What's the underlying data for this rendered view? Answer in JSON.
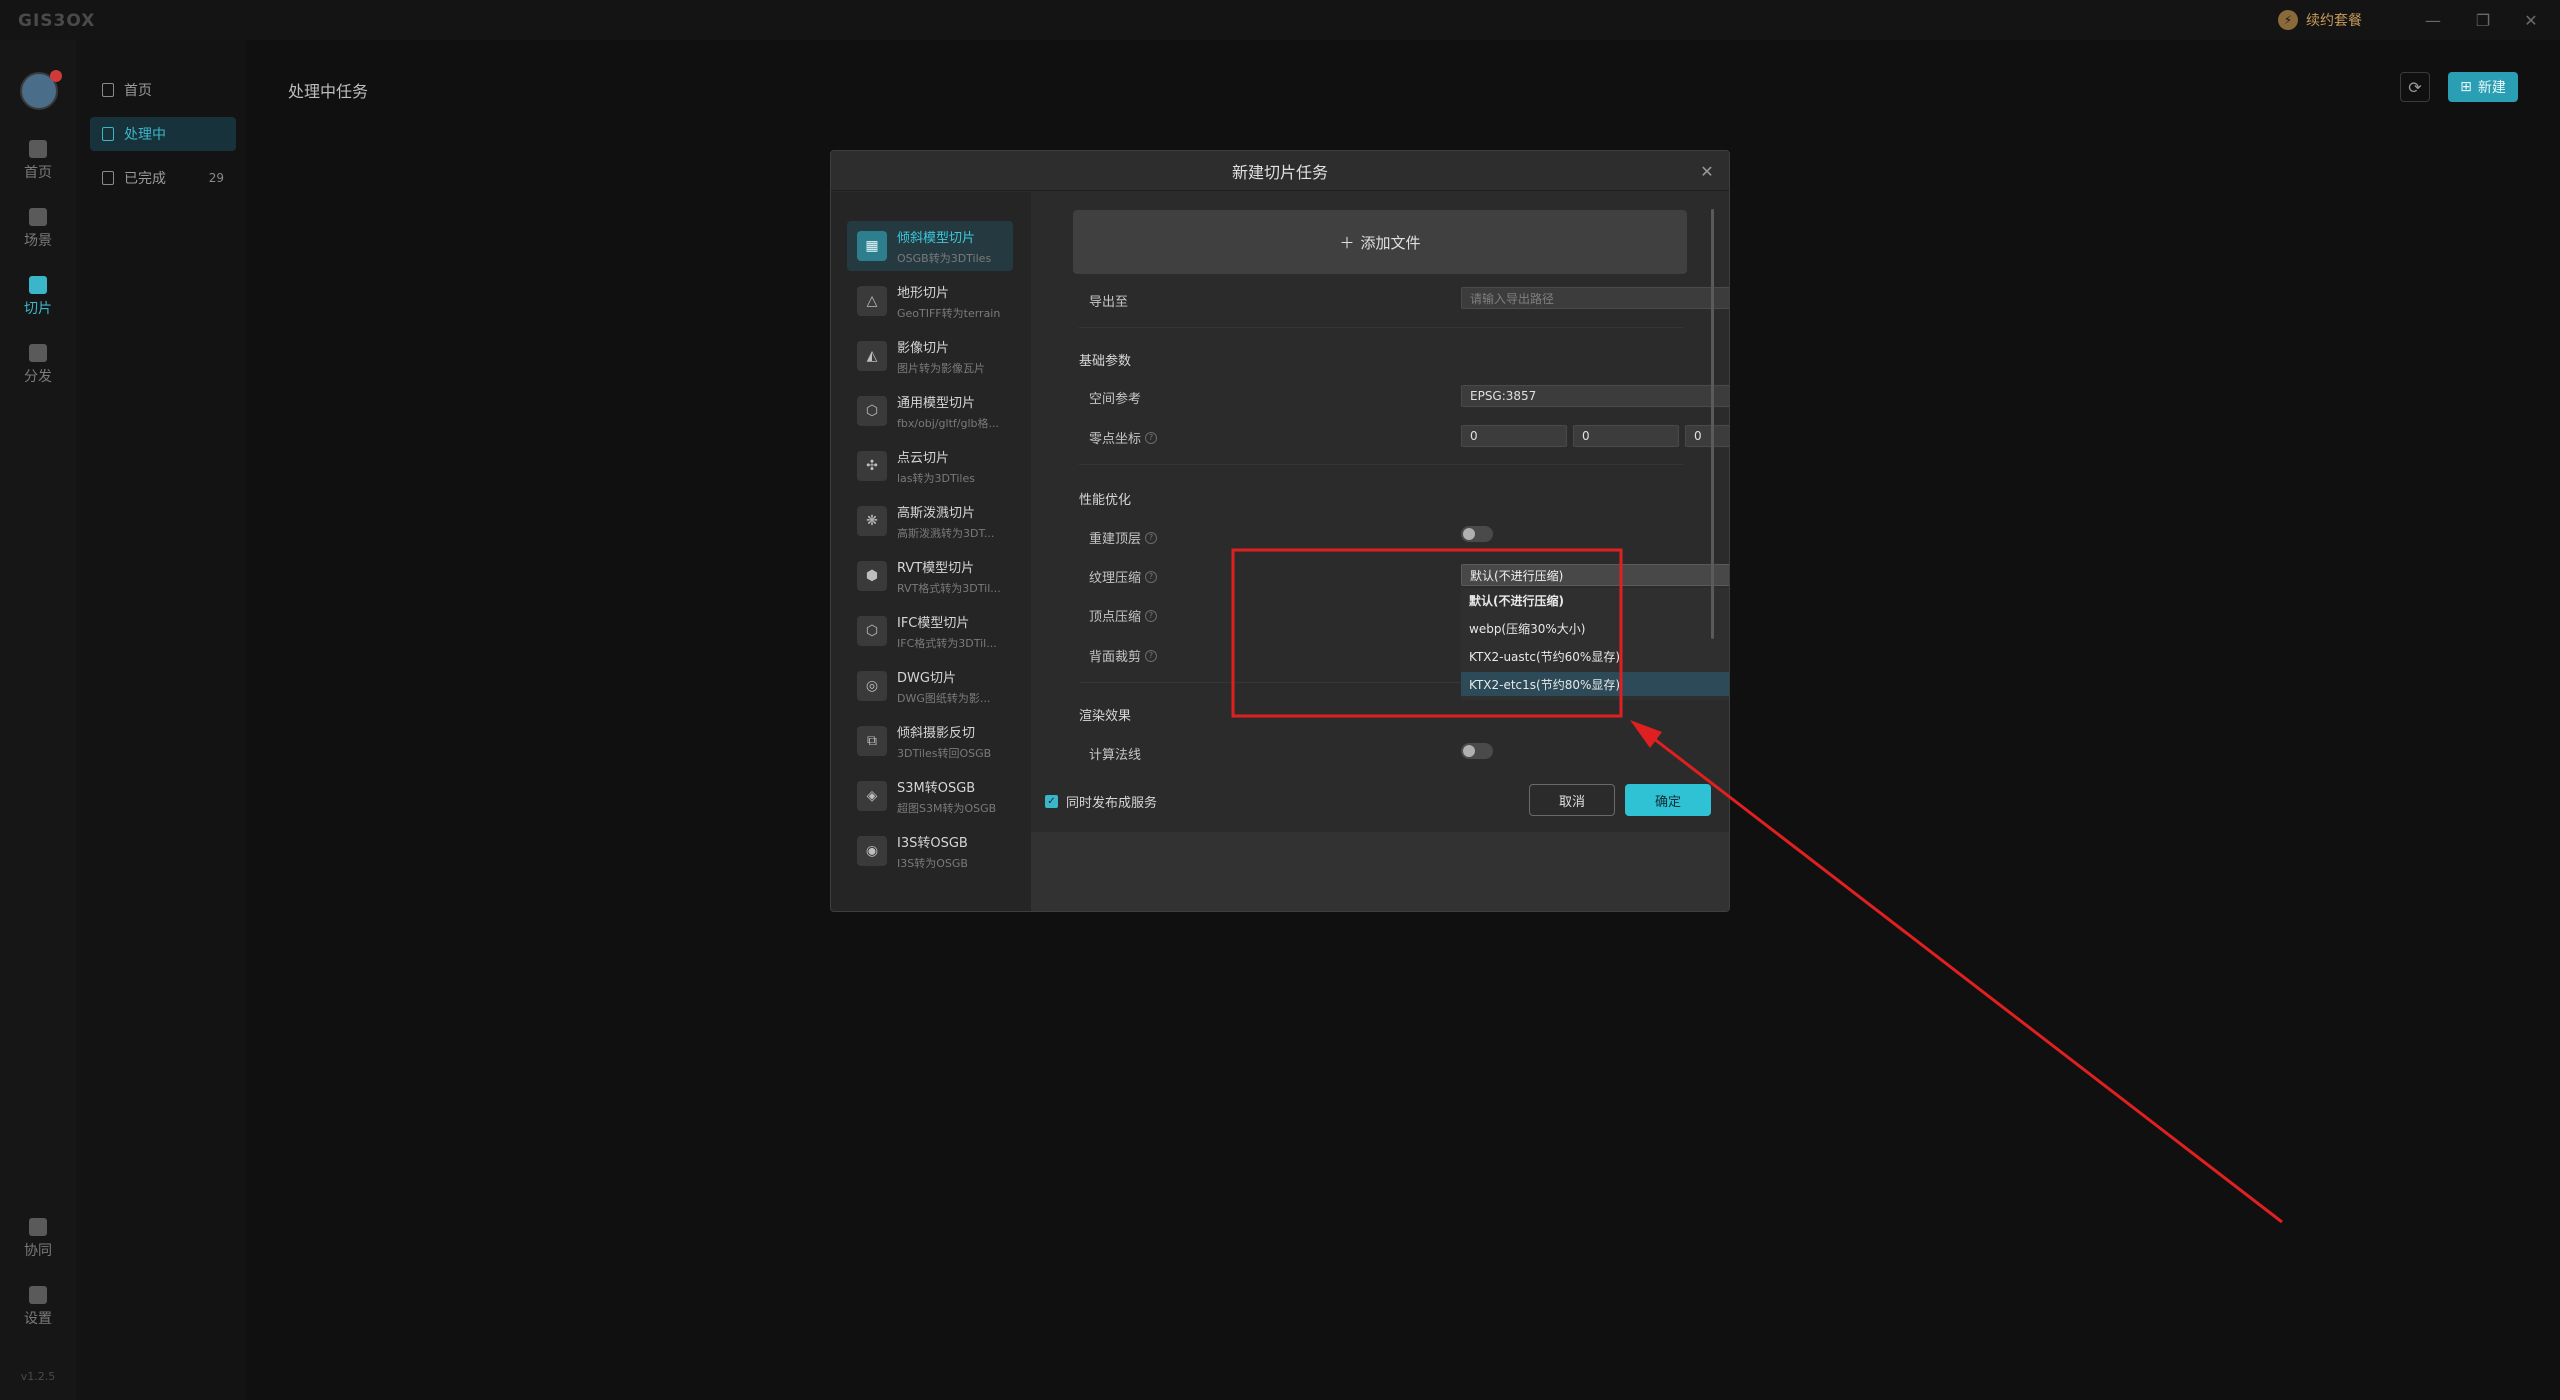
{
  "app": {
    "logo": "GIS3OX",
    "plan_label": "续约套餐",
    "plan_icon": "lightning-icon",
    "window_controls": [
      "minimize-icon",
      "restore-icon",
      "close-icon"
    ],
    "version": "v1.2.5"
  },
  "rail": {
    "items": [
      {
        "label": "首页",
        "icon": "home-icon"
      },
      {
        "label": "场景",
        "icon": "scene-icon"
      },
      {
        "label": "切片",
        "icon": "slice-icon"
      },
      {
        "label": "分发",
        "icon": "distribute-icon"
      },
      {
        "label": "协同",
        "icon": "collaborate-icon"
      },
      {
        "label": "设置",
        "icon": "settings-icon"
      }
    ]
  },
  "subnav": {
    "items": [
      {
        "label": "首页"
      },
      {
        "label": "处理中"
      },
      {
        "label": "已完成",
        "count": "29"
      }
    ]
  },
  "main": {
    "title": "处理中任务",
    "new_label": "新建"
  },
  "dialog": {
    "title": "新建切片任务",
    "types": [
      {
        "name": "倾斜模型切片",
        "sub": "OSGB转为3DTiles",
        "icon": "grid-icon"
      },
      {
        "name": "地形切片",
        "sub": "GeoTIFF转为terrain",
        "icon": "terrain-icon"
      },
      {
        "name": "影像切片",
        "sub": "图片转为影像瓦片",
        "icon": "image-icon"
      },
      {
        "name": "通用模型切片",
        "sub": "fbx/obj/gltf/glb格...",
        "icon": "cube-icon"
      },
      {
        "name": "点云切片",
        "sub": "las转为3DTiles",
        "icon": "pointcloud-icon"
      },
      {
        "name": "高斯泼溅切片",
        "sub": "高斯泼溅转为3DT...",
        "icon": "gaussian-icon"
      },
      {
        "name": "RVT模型切片",
        "sub": "RVT格式转为3DTil...",
        "icon": "rvt-icon"
      },
      {
        "name": "IFC模型切片",
        "sub": "IFC格式转为3DTil...",
        "icon": "ifc-icon"
      },
      {
        "name": "DWG切片",
        "sub": "DWG图纸转为影...",
        "icon": "dwg-icon"
      },
      {
        "name": "倾斜摄影反切",
        "sub": "3DTiles转回OSGB",
        "icon": "reverse-icon"
      },
      {
        "name": "S3M转OSGB",
        "sub": "超图S3M转为OSGB",
        "icon": "s3m-icon"
      },
      {
        "name": "I3S转OSGB",
        "sub": "I3S转为OSGB",
        "icon": "i3s-icon"
      }
    ],
    "add_file": "添加文件",
    "export_label": "导出至",
    "export_placeholder": "请输入导出路径",
    "basic_section": "基础参数",
    "crs_label": "空间参考",
    "crs_value": "EPSG:3857",
    "origin_label": "零点坐标",
    "origin_values": [
      "0",
      "0",
      "0"
    ],
    "perf_section": "性能优化",
    "rebuild_label": "重建顶层",
    "texture_label": "纹理压缩",
    "texture_selected": "默认(不进行压缩)",
    "texture_options": [
      "默认(不进行压缩)",
      "webp(压缩30%大小)",
      "KTX2-uastc(节约60%显存)",
      "KTX2-etc1s(节约80%显存)"
    ],
    "vertex_label": "顶点压缩",
    "backface_label": "背面裁剪",
    "render_section": "渲染效果",
    "normals_label": "计算法线",
    "publish_label": "同时发布成服务",
    "cancel": "取消",
    "ok": "确定"
  },
  "annotation": {
    "highlight_color": "#e02020"
  }
}
